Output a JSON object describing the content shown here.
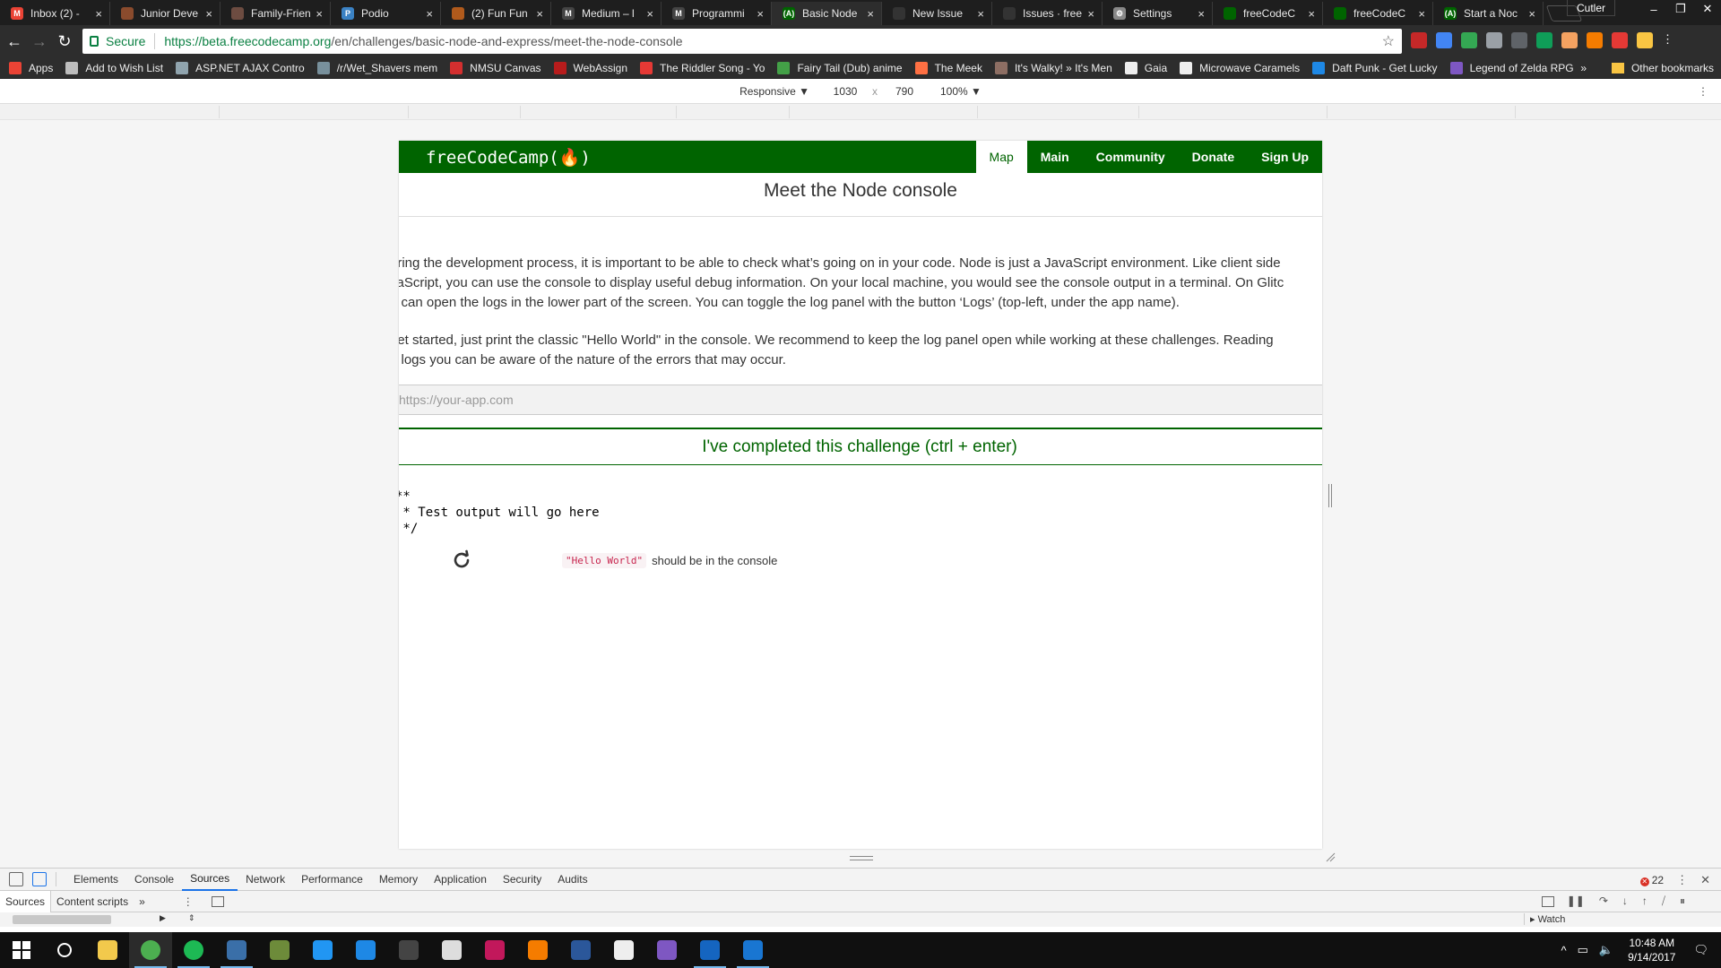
{
  "browser": {
    "tabs": [
      {
        "title": "Inbox (2) -",
        "color": "#ea4335",
        "glyph": "M"
      },
      {
        "title": "Junior Deve",
        "color": "#8a4b2d",
        "glyph": ""
      },
      {
        "title": "Family-Frien",
        "color": "#6d4c41",
        "glyph": ""
      },
      {
        "title": "Podio",
        "color": "#3b82c4",
        "glyph": "P"
      },
      {
        "title": "(2) Fun Fun",
        "color": "#b05a1c",
        "glyph": ""
      },
      {
        "title": "Medium – l",
        "color": "#444444",
        "glyph": "M"
      },
      {
        "title": "Programmi",
        "color": "#444444",
        "glyph": "M"
      },
      {
        "title": "Basic Node",
        "color": "#006400",
        "glyph": "(A)"
      },
      {
        "title": "New Issue",
        "color": "#333333",
        "glyph": ""
      },
      {
        "title": "Issues · free",
        "color": "#333333",
        "glyph": ""
      },
      {
        "title": "Settings",
        "color": "#888888",
        "glyph": "⚙"
      },
      {
        "title": "freeCodeC",
        "color": "#006400",
        "glyph": ""
      },
      {
        "title": "freeCodeC",
        "color": "#006400",
        "glyph": ""
      },
      {
        "title": "Start a Noc",
        "color": "#006400",
        "glyph": "(A)"
      }
    ],
    "active_tab_index": 7,
    "user_label": "Cutler",
    "window_controls": [
      "–",
      "❐",
      "✕"
    ],
    "secure_label": "Secure",
    "url_host": "https://beta.freecodecamp.org",
    "url_path": "/en/challenges/basic-node-and-express/meet-the-node-console",
    "star_icon": "☆"
  },
  "extensions": [
    "#c62828",
    "#4285f4",
    "#34a853",
    "#9aa0a6",
    "#5f6368",
    "#0f9d58",
    "#f4a261",
    "#f57c00",
    "#e53935",
    "#f9c543"
  ],
  "bookmarks": {
    "items": [
      {
        "label": "Apps",
        "color": "#ea4335"
      },
      {
        "label": "Add to Wish List",
        "color": "#bdbdbd"
      },
      {
        "label": "ASP.NET AJAX Contro",
        "color": "#90a4ae"
      },
      {
        "label": "/r/Wet_Shavers mem",
        "color": "#78909c"
      },
      {
        "label": "NMSU Canvas",
        "color": "#d32f2f"
      },
      {
        "label": "WebAssign",
        "color": "#b71c1c"
      },
      {
        "label": "The Riddler Song - Yo",
        "color": "#e53935"
      },
      {
        "label": "Fairy Tail (Dub) anime",
        "color": "#43a047"
      },
      {
        "label": "The Meek",
        "color": "#ff7043"
      },
      {
        "label": "It's Walky! » It's Men",
        "color": "#8d6e63"
      },
      {
        "label": "Gaia",
        "color": "#eeeeee"
      },
      {
        "label": "Microwave Caramels",
        "color": "#eeeeee"
      },
      {
        "label": "Daft Punk - Get Lucky",
        "color": "#1e88e5"
      },
      {
        "label": "Legend of Zelda RPG",
        "color": "#7e57c2"
      }
    ],
    "more": "»",
    "other": "Other bookmarks"
  },
  "device_toolbar": {
    "mode": "Responsive ▼",
    "width": "1030",
    "times": "x",
    "height": "790",
    "zoom": "100% ▼",
    "menu": "⋮"
  },
  "fcc": {
    "logo": "freeCodeCamp(🔥)",
    "nav": [
      {
        "label": "Map",
        "active": true
      },
      {
        "label": "Main",
        "active": false
      },
      {
        "label": "Community",
        "active": false
      },
      {
        "label": "Donate",
        "active": false
      },
      {
        "label": "Sign Up",
        "active": false
      }
    ],
    "challenge_title": "Meet the Node console",
    "description_lines": [
      "uring the development process, it is important to be able to check what’s going on in your code. Node is just a JavaScript environment. Like client side",
      "vaScript, you can use the console to display useful debug information. On your local machine, you would see the console output in a terminal. On Glitc",
      "u can open the logs in the lower part of the screen. You can toggle the log panel with the button ‘Logs’ (top-left, under the app name)."
    ],
    "description2_lines": [
      "get started, just print the classic \"Hello World\" in the console. We recommend to keep the log panel open while working at these challenges. Reading",
      "e logs you can be aware of the nature of the errors that may occur."
    ],
    "url_placeholder": "https://your-app.com",
    "complete_button": "I've completed this challenge (ctrl + enter)",
    "test_output": "**\n * Test output will go here\n */",
    "test_code": "\"Hello World\"",
    "test_text": "should be in the console"
  },
  "devtools": {
    "tabs": [
      "Elements",
      "Console",
      "Sources",
      "Network",
      "Performance",
      "Memory",
      "Application",
      "Security",
      "Audits"
    ],
    "active": "Sources",
    "error_count": "22",
    "sub_tabs": [
      "Sources",
      "Content scripts"
    ],
    "sub_more": "»",
    "watch_label": "Watch"
  },
  "taskbar": {
    "apps": [
      {
        "name": "start",
        "color": "#ffffff"
      },
      {
        "name": "cortana",
        "color": "#ffffff"
      },
      {
        "name": "file-explorer",
        "color": "#f2c94c"
      },
      {
        "name": "chrome",
        "color": "#4caf50"
      },
      {
        "name": "spotify",
        "color": "#1db954"
      },
      {
        "name": "steam",
        "color": "#3a6fa8"
      },
      {
        "name": "minecraft",
        "color": "#6d8b3a"
      },
      {
        "name": "dolphin",
        "color": "#2196f3"
      },
      {
        "name": "edge",
        "color": "#1e88e5"
      },
      {
        "name": "terminal",
        "color": "#444444"
      },
      {
        "name": "overwatch",
        "color": "#dddddd"
      },
      {
        "name": "intellij",
        "color": "#c2185b"
      },
      {
        "name": "blender",
        "color": "#f57c00"
      },
      {
        "name": "word",
        "color": "#2b579a"
      },
      {
        "name": "unity",
        "color": "#eeeeee"
      },
      {
        "name": "visual-studio",
        "color": "#7e57c2"
      },
      {
        "name": "powershell",
        "color": "#1565c0"
      },
      {
        "name": "app",
        "color": "#1976d2"
      }
    ],
    "time": "10:48 AM",
    "date": "9/14/2017"
  }
}
